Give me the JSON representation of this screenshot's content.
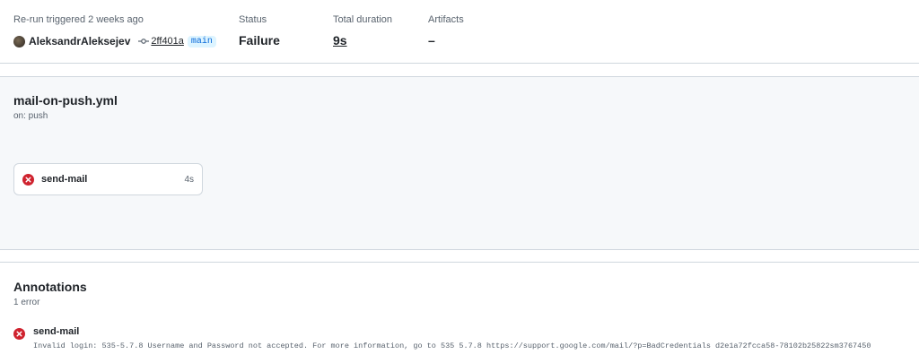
{
  "summary": {
    "trigger_label": "Re-run triggered 2 weeks ago",
    "actor": "AleksandrAleksejev",
    "commit_sha": "2ff401a",
    "branch": "main",
    "status_label": "Status",
    "status_value": "Failure",
    "duration_label": "Total duration",
    "duration_value": "9s",
    "artifacts_label": "Artifacts",
    "artifacts_value": "–"
  },
  "workflow": {
    "file_name": "mail-on-push.yml",
    "trigger": "on: push",
    "jobs": [
      {
        "name": "send-mail",
        "duration": "4s",
        "status": "failure"
      }
    ]
  },
  "annotations": {
    "title": "Annotations",
    "count": "1 error",
    "items": [
      {
        "job": "send-mail",
        "message": "Invalid login: 535-5.7.8 Username and Password not accepted. For more information, go to 535 5.7.8 https://support.google.com/mail/?p=BadCredentials d2e1a72fcca58-78102b25822sm3767450"
      }
    ]
  },
  "colors": {
    "error": "#cf222e",
    "link": "#0969da",
    "border": "#d0d7de",
    "graph_bg": "#f6f8fa"
  },
  "icons": {
    "status": "x-circle-icon",
    "commit": "git-commit-icon"
  }
}
